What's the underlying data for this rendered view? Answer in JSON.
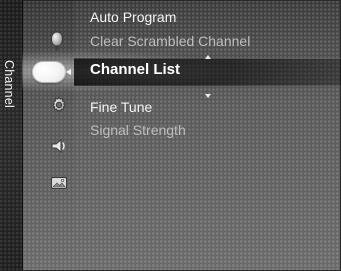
{
  "side_tab": {
    "label": "Channel"
  },
  "icons": [
    {
      "name": "antenna-icon"
    },
    {
      "name": "channel-icon"
    },
    {
      "name": "settings-icon"
    },
    {
      "name": "speaker-icon"
    },
    {
      "name": "picture-icon"
    }
  ],
  "menu": {
    "items": [
      {
        "label": "Auto Program",
        "state": "enabled"
      },
      {
        "label": "Clear Scrambled Channel",
        "state": "disabled"
      },
      {
        "label": "Channel List",
        "state": "selected"
      },
      {
        "label": "Fine Tune",
        "state": "enabled"
      },
      {
        "label": "Signal Strength",
        "state": "disabled"
      }
    ]
  }
}
